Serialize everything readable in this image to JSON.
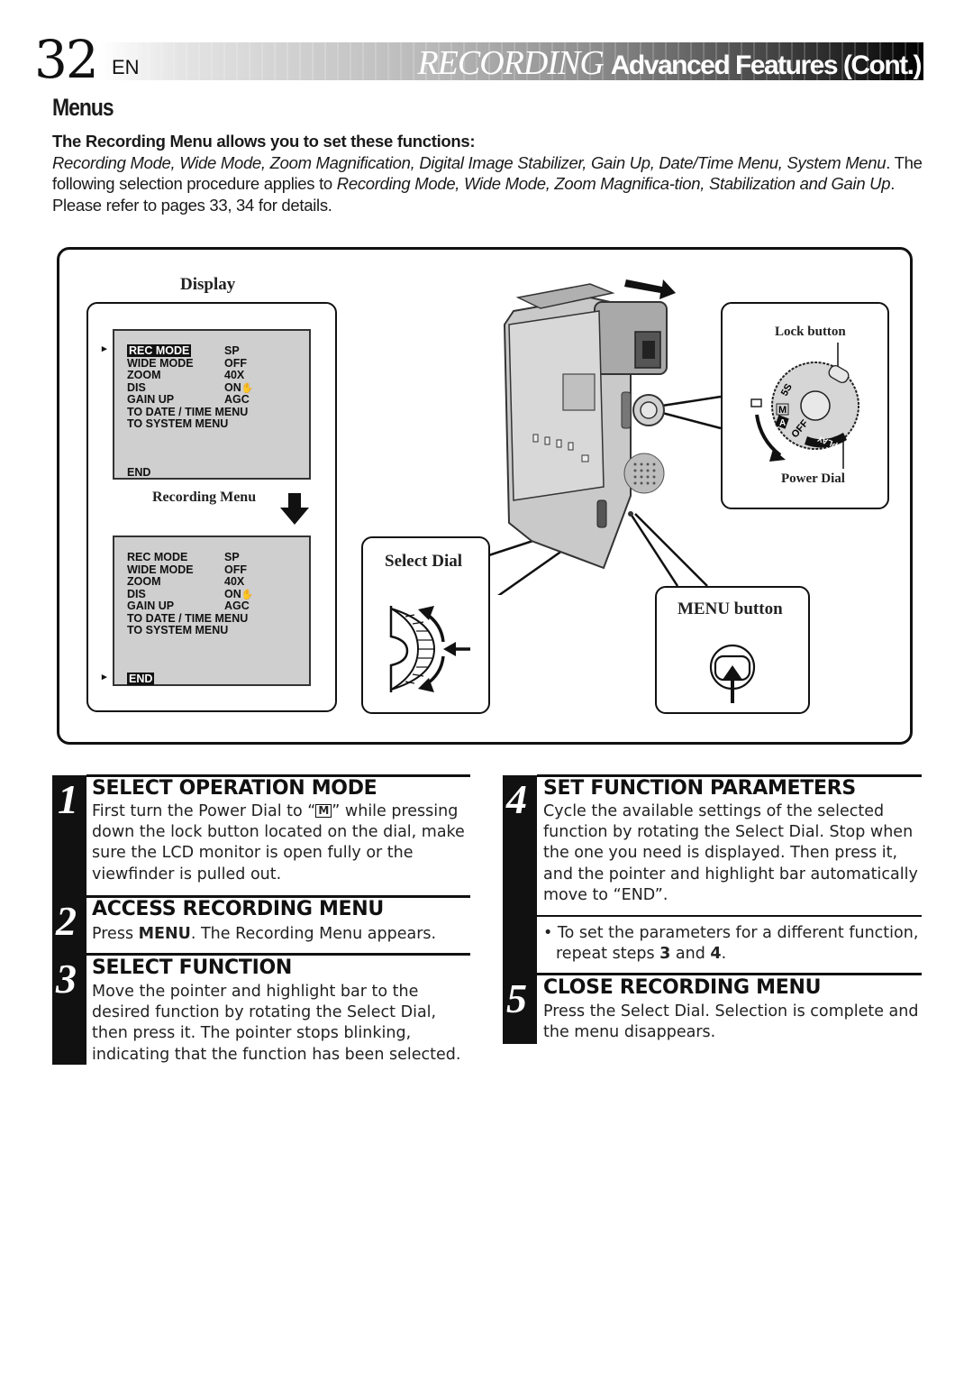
{
  "header": {
    "page_number": "32",
    "language": "EN",
    "title_primary": "RECORDING",
    "title_secondary": "Advanced Features (Cont.)"
  },
  "section": {
    "title": "Menus",
    "intro_lead": "The Recording Menu allows you to set these functions:",
    "intro_functions": "Recording Mode, Wide Mode, Zoom Magnification, Digital Image Stabilizer, Gain Up, Date/Time Menu, System Menu",
    "intro_procedure_prefix": ". The following selection procedure applies to ",
    "intro_procedure_items": "Recording Mode, Wide Mode, Zoom Magnifica-tion, Stabilization and Gain Up",
    "intro_procedure_suffix": ".",
    "intro_refer": "Please refer to pages 33, 34 for details."
  },
  "figure": {
    "display_label": "Display",
    "recording_menu_label": "Recording Menu",
    "lcd_before": {
      "highlighted": "REC MODE",
      "rows": [
        {
          "name": "REC MODE",
          "value": "SP"
        },
        {
          "name": "WIDE MODE",
          "value": "OFF"
        },
        {
          "name": "ZOOM",
          "value": "40X"
        },
        {
          "name": "DIS",
          "value": "ON"
        },
        {
          "name": "GAIN UP",
          "value": "AGC"
        },
        {
          "name": "TO DATE / TIME MENU",
          "value": ""
        },
        {
          "name": "TO SYSTEM MENU",
          "value": ""
        }
      ],
      "end": "END"
    },
    "lcd_after": {
      "highlighted": "END",
      "rows": [
        {
          "name": "REC MODE",
          "value": "SP"
        },
        {
          "name": "WIDE MODE",
          "value": "OFF"
        },
        {
          "name": "ZOOM",
          "value": "40X"
        },
        {
          "name": "DIS",
          "value": "ON"
        },
        {
          "name": "GAIN UP",
          "value": "AGC"
        },
        {
          "name": "TO DATE / TIME MENU",
          "value": ""
        },
        {
          "name": "TO SYSTEM MENU",
          "value": ""
        }
      ],
      "end": "END"
    },
    "lock_button_label": "Lock button",
    "power_dial_label": "Power Dial",
    "power_dial_positions": [
      "5S",
      "M",
      "A",
      "OFF",
      "PLAY"
    ],
    "select_dial_label": "Select Dial",
    "menu_button_label": "MENU button"
  },
  "steps": [
    {
      "number": "1",
      "title": "SELECT OPERATION MODE",
      "body_pre": "First turn the Power Dial to “",
      "body_icon": "M",
      "body_post": "” while pressing down the lock button located on the dial, make sure the LCD monitor is open fully or the viewfinder is pulled out."
    },
    {
      "number": "2",
      "title": "ACCESS RECORDING MENU",
      "body_pre": "Press ",
      "body_bold": "MENU",
      "body_post": ". The Recording Menu appears."
    },
    {
      "number": "3",
      "title": "SELECT FUNCTION",
      "body": "Move the pointer and highlight bar to the desired function by rotating the Select Dial, then press it. The pointer stops blinking, indicating that the function has been selected."
    },
    {
      "number": "4",
      "title": "SET FUNCTION PARAMETERS",
      "body": "Cycle the available settings of the selected function by rotating the Select Dial. Stop when the one you need is displayed. Then press it, and the pointer and highlight bar automatically move to “END”.",
      "note_pre": "• To set the parameters for a different function, repeat steps ",
      "note_b1": "3",
      "note_mid": " and ",
      "note_b2": "4",
      "note_post": "."
    },
    {
      "number": "5",
      "title": "CLOSE RECORDING MENU",
      "body": "Press the Select Dial. Selection is complete and the menu disappears."
    }
  ]
}
